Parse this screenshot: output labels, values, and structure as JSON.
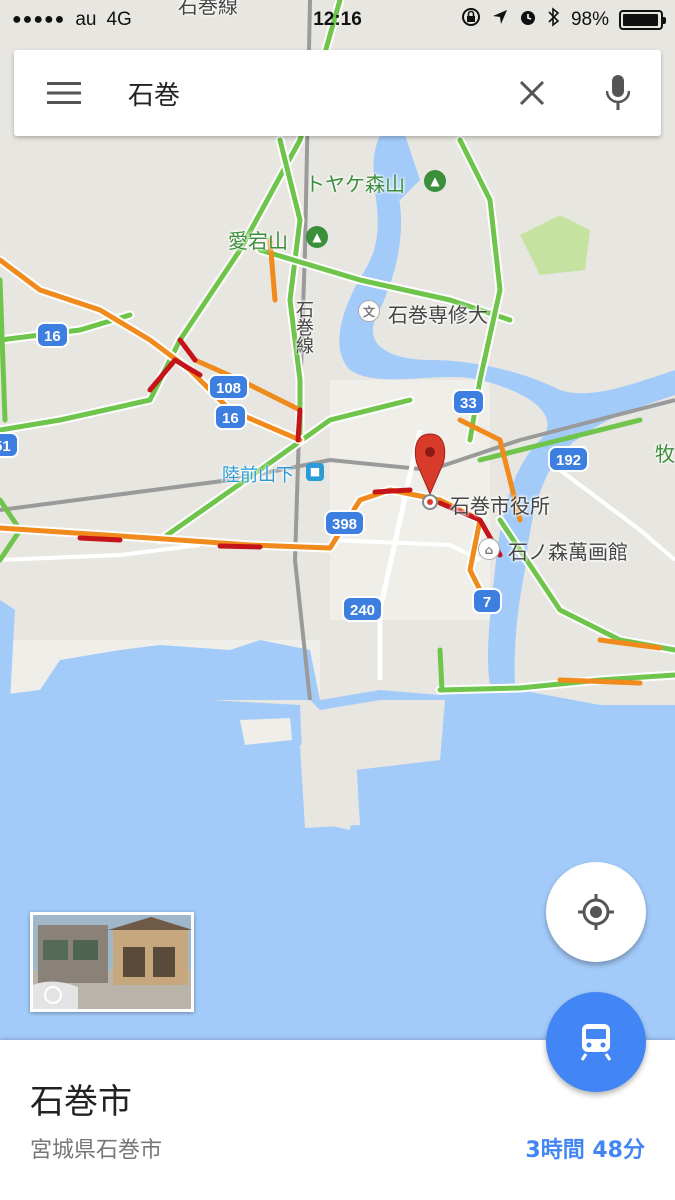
{
  "status_bar": {
    "carrier": "au",
    "network": "4G",
    "time": "12:16",
    "battery": "98%",
    "battery_level": 0.98
  },
  "search": {
    "query": "石巻",
    "menu_icon": "hamburger-menu-icon",
    "clear_icon": "close-icon",
    "mic_icon": "microphone-icon"
  },
  "map": {
    "labels": {
      "rail_top": "石巻線",
      "mountain_1": "トヤケ森山",
      "mountain_2": "愛宕山",
      "university": "石巻専修大",
      "rail_vertical": "石巻線",
      "station": "陸前山下",
      "city_hall": "石巻市役所",
      "museum": "石ノ森萬画館",
      "edge_right": "牧"
    },
    "route_shields": {
      "r16a": "16",
      "r108": "108",
      "r16b": "16",
      "r51": "51",
      "r33": "33",
      "r192": "192",
      "r398": "398",
      "r240": "240",
      "r7": "7"
    },
    "colors": {
      "water": "#a3cbfa",
      "land": "#e8e6e0",
      "park": "#c6e2a0",
      "traffic_green": "#6fc54c",
      "traffic_orange": "#f08a1c",
      "traffic_red": "#c5131a",
      "pin": "#d93b2b"
    }
  },
  "place": {
    "name": "石巻市",
    "address": "宮城県石巻市",
    "travel_time": "3時間 48分"
  },
  "buttons": {
    "my_location_icon": "my-location-icon",
    "transit_icon": "train-icon"
  }
}
